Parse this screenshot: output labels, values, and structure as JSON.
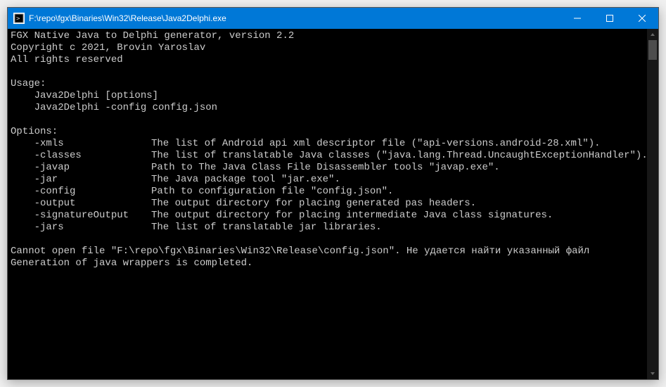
{
  "window": {
    "title": "F:\\repo\\fgx\\Binaries\\Win32\\Release\\Java2Delphi.exe"
  },
  "header": {
    "line1": "FGX Native Java to Delphi generator, version 2.2",
    "line2": "Copyright c 2021, Brovin Yaroslav",
    "line3": "All rights reserved"
  },
  "usage": {
    "label": "Usage:",
    "line1": "    Java2Delphi [options]",
    "line2": "    Java2Delphi -config config.json"
  },
  "options": {
    "label": "Options:",
    "items": [
      {
        "flag": "    -xmls",
        "desc": "The list of Android api xml descriptor file (\"api-versions.android-28.xml\")."
      },
      {
        "flag": "    -classes",
        "desc": "The list of translatable Java classes (\"java.lang.Thread.UncaughtExceptionHandler\")."
      },
      {
        "flag": "    -javap",
        "desc": "Path to The Java Class File Disassembler tools \"javap.exe\"."
      },
      {
        "flag": "    -jar",
        "desc": "The Java package tool \"jar.exe\"."
      },
      {
        "flag": "    -config",
        "desc": "Path to configuration file \"config.json\"."
      },
      {
        "flag": "    -output",
        "desc": "The output directory for placing generated pas headers."
      },
      {
        "flag": "    -signatureOutput",
        "desc": "The output directory for placing intermediate Java class signatures."
      },
      {
        "flag": "    -jars",
        "desc": "The list of translatable jar libraries."
      }
    ]
  },
  "footer": {
    "error": "Cannot open file \"F:\\repo\\fgx\\Binaries\\Win32\\Release\\config.json\". Не удается найти указанный файл",
    "done": "Generation of java wrappers is completed."
  }
}
